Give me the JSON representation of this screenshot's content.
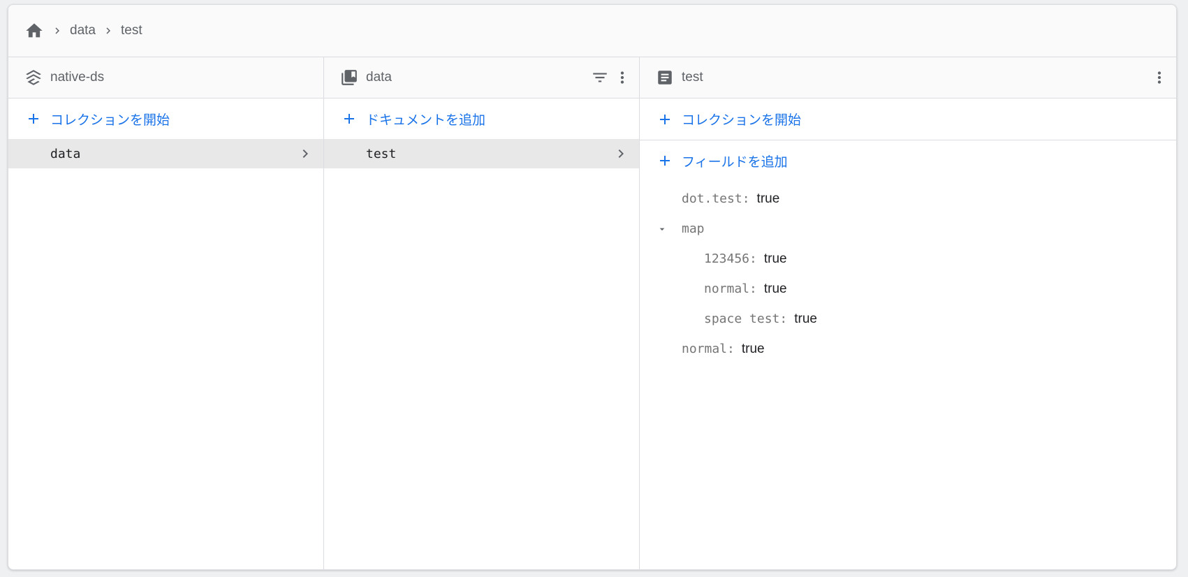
{
  "breadcrumb": {
    "home_icon": "home-icon",
    "items": [
      "data",
      "test"
    ]
  },
  "columns": {
    "root": {
      "title": "native-ds",
      "icon": "database-stack-icon",
      "action_label": "コレクションを開始",
      "items": [
        {
          "label": "data",
          "selected": true
        }
      ]
    },
    "collection": {
      "title": "data",
      "icon": "collection-icon",
      "action_label": "ドキュメントを追加",
      "items": [
        {
          "label": "test",
          "selected": true
        }
      ]
    },
    "document": {
      "title": "test",
      "icon": "document-icon",
      "collection_action_label": "コレクションを開始",
      "field_action_label": "フィールドを追加",
      "fields": {
        "dot_test": {
          "key": "dot.test",
          "value": "true"
        },
        "map": {
          "key": "map",
          "children": [
            {
              "key": "123456",
              "value": "true"
            },
            {
              "key": "normal",
              "value": "true"
            },
            {
              "key": "space test",
              "value": "true"
            }
          ]
        },
        "normal": {
          "key": "normal",
          "value": "true"
        }
      }
    }
  },
  "colors": {
    "accent": "#1a73e8",
    "icon_grey": "#5f6368",
    "selected_row": "#e8e8e8",
    "border": "#dadce0"
  }
}
